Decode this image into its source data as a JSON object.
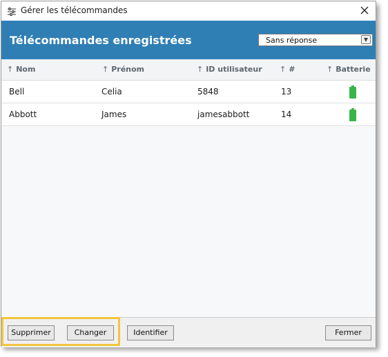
{
  "window": {
    "title": "Gérer les télécommandes",
    "close_icon": "close-icon",
    "app_icon": "sliders-icon"
  },
  "header": {
    "title": "Télécommandes enregistrées",
    "filter": {
      "selected": "Sans réponse"
    },
    "accent_color": "#2f7fb5"
  },
  "table": {
    "columns": [
      "Nom",
      "Prénom",
      "ID utilisateur",
      "#",
      "Batterie"
    ],
    "sort_icon": "arrow-up-icon",
    "rows": [
      {
        "nom": "Bell",
        "prenom": "Celia",
        "id": "5848",
        "num": "13",
        "battery": "battery-full-icon"
      },
      {
        "nom": "Abbott",
        "prenom": "James",
        "id": "jamesabbott",
        "num": "14",
        "battery": "battery-full-icon"
      }
    ]
  },
  "footer": {
    "delete_label": "Supprimer",
    "change_label": "Changer",
    "identify_label": "Identifier",
    "close_label": "Fermer",
    "highlight_color": "#f2c53d"
  },
  "battery_color": "#3ab54a"
}
